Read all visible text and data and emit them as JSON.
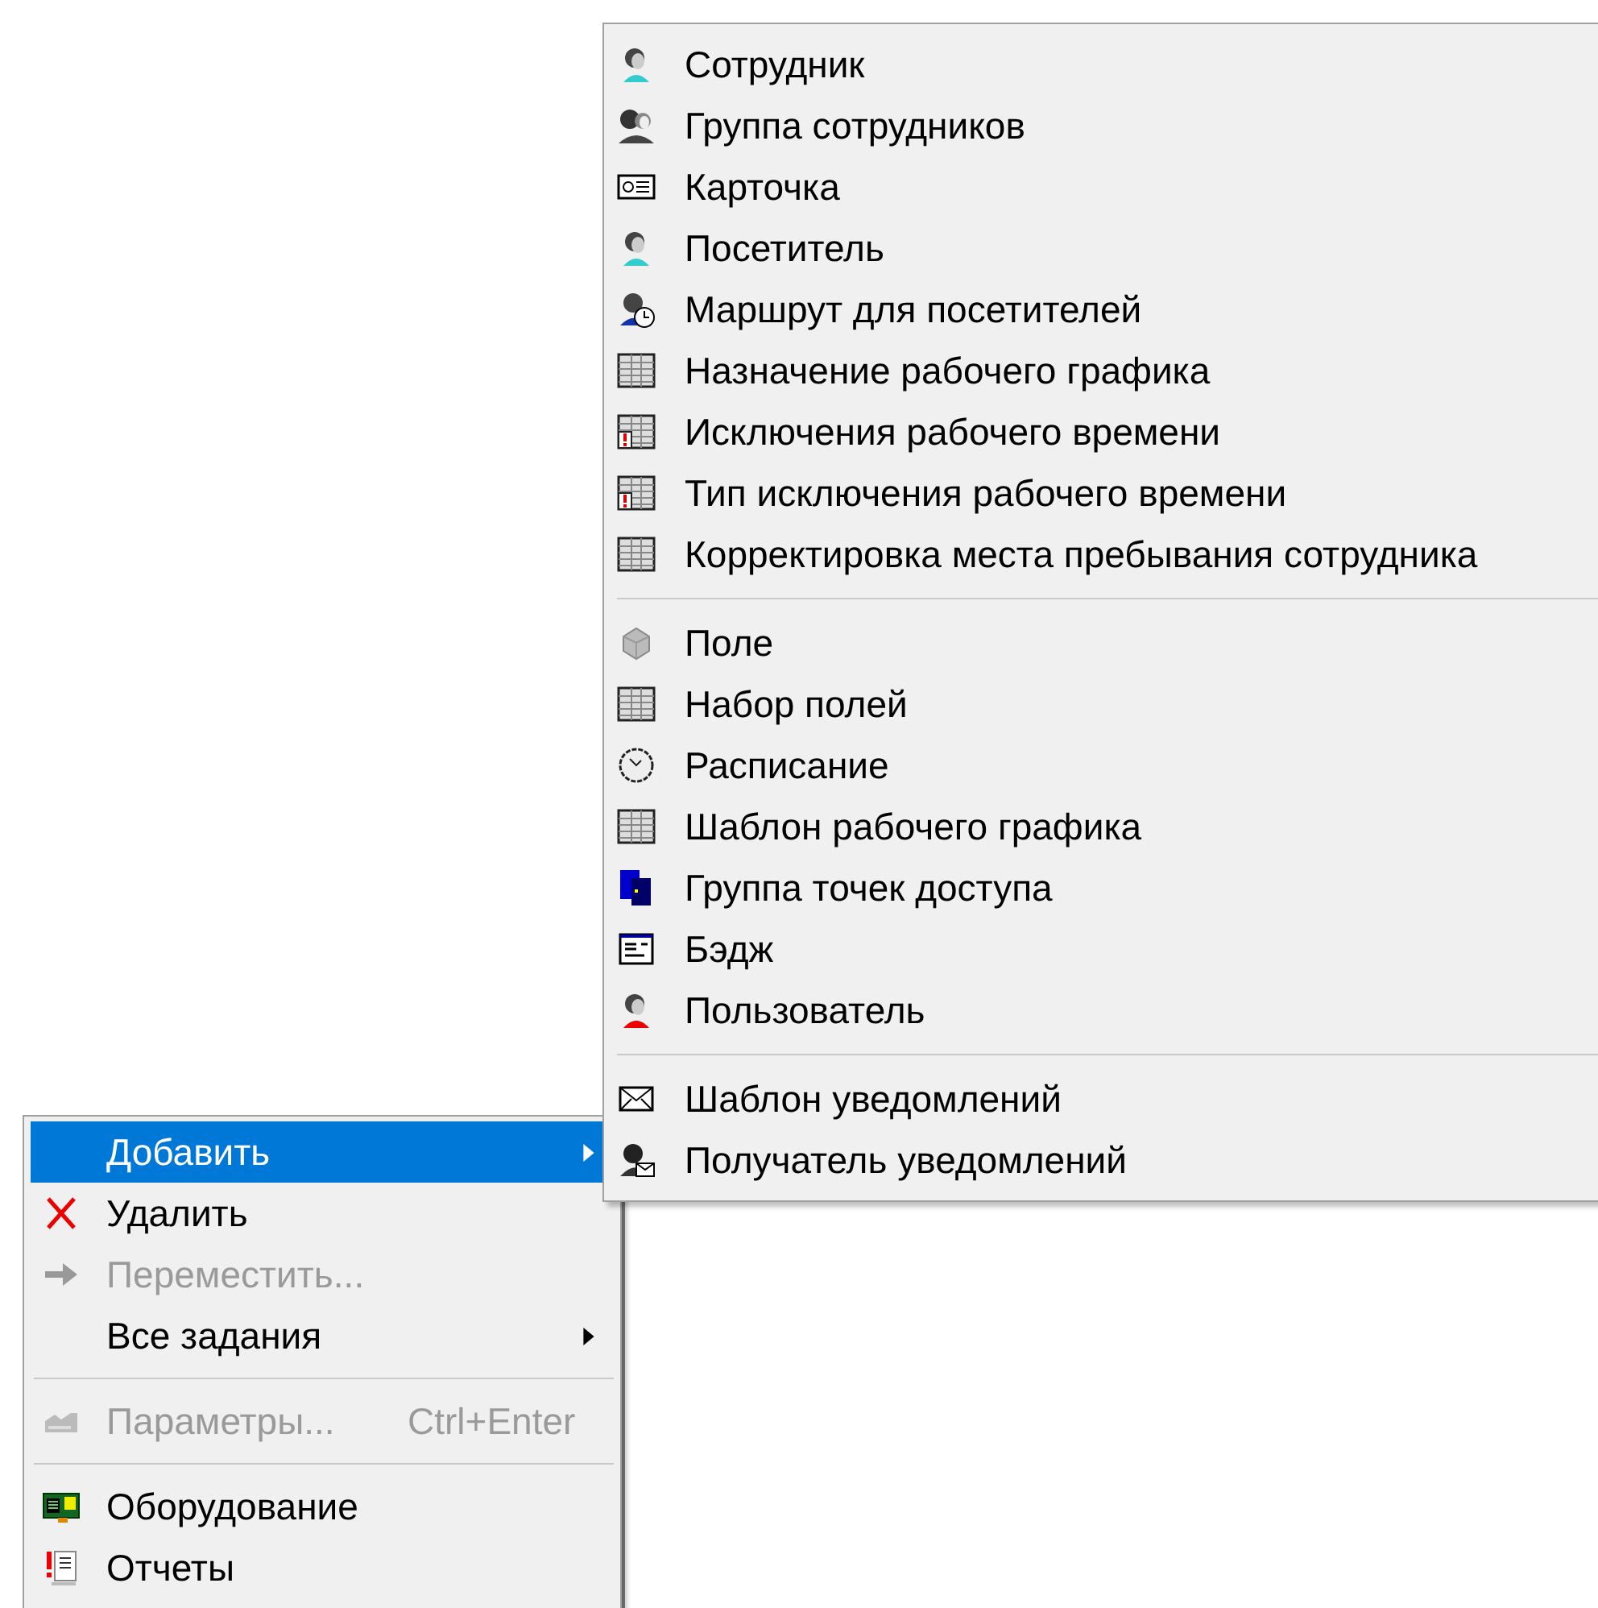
{
  "context_menu": {
    "sections": [
      [
        {
          "label": "Добавить",
          "selected": true,
          "disabled": false,
          "submenu": true
        },
        {
          "label": "Удалить",
          "selected": false,
          "disabled": false,
          "submenu": false
        },
        {
          "label": "Переместить...",
          "selected": false,
          "disabled": true,
          "submenu": false
        },
        {
          "label": "Все задания",
          "selected": false,
          "disabled": false,
          "submenu": true
        }
      ],
      [
        {
          "label": "Параметры...",
          "shortcut": "Ctrl+Enter",
          "selected": false,
          "disabled": true,
          "submenu": false
        }
      ],
      [
        {
          "label": "Оборудование",
          "selected": false,
          "disabled": false,
          "submenu": false
        },
        {
          "label": "Отчеты",
          "selected": false,
          "disabled": false,
          "submenu": false
        }
      ]
    ]
  },
  "submenu": {
    "sections": [
      [
        {
          "label": "Сотрудник"
        },
        {
          "label": "Группа сотрудников"
        },
        {
          "label": "Карточка"
        },
        {
          "label": "Посетитель"
        },
        {
          "label": "Маршрут для посетителей"
        },
        {
          "label": "Назначение рабочего графика"
        },
        {
          "label": "Исключения рабочего времени"
        },
        {
          "label": "Тип исключения рабочего времени"
        },
        {
          "label": "Корректировка места пребывания сотрудника"
        }
      ],
      [
        {
          "label": "Поле"
        },
        {
          "label": "Набор полей"
        },
        {
          "label": "Расписание"
        },
        {
          "label": "Шаблон рабочего графика"
        },
        {
          "label": "Группа точек доступа"
        },
        {
          "label": "Бэдж"
        },
        {
          "label": "Пользователь"
        }
      ],
      [
        {
          "label": "Шаблон уведомлений"
        },
        {
          "label": "Получатель уведомлений"
        }
      ]
    ]
  }
}
